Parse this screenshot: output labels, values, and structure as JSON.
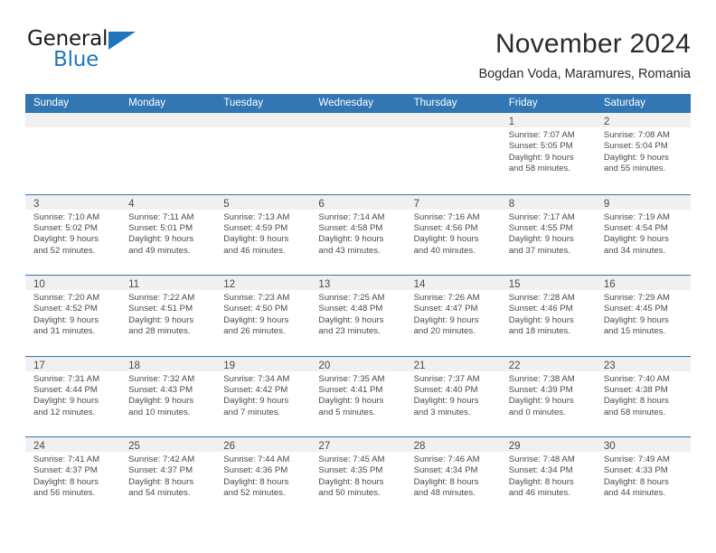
{
  "brand": {
    "name_top": "General",
    "name_bottom": "Blue",
    "accent_color": "#1f76bd",
    "triangle_icon": "brand-triangle-icon"
  },
  "header": {
    "title": "November 2024",
    "subtitle": "Bogdan Voda, Maramures, Romania"
  },
  "theme": {
    "header_blue": "#3276b4",
    "day_band_gray": "#f0f0f0",
    "text_gray": "#4a4a4a"
  },
  "weekdays": [
    "Sunday",
    "Monday",
    "Tuesday",
    "Wednesday",
    "Thursday",
    "Friday",
    "Saturday"
  ],
  "weeks": [
    [
      {
        "day": "",
        "empty": true
      },
      {
        "day": "",
        "empty": true
      },
      {
        "day": "",
        "empty": true
      },
      {
        "day": "",
        "empty": true
      },
      {
        "day": "",
        "empty": true
      },
      {
        "day": "1",
        "sunrise": "Sunrise: 7:07 AM",
        "sunset": "Sunset: 5:05 PM",
        "daylight1": "Daylight: 9 hours",
        "daylight2": "and 58 minutes."
      },
      {
        "day": "2",
        "sunrise": "Sunrise: 7:08 AM",
        "sunset": "Sunset: 5:04 PM",
        "daylight1": "Daylight: 9 hours",
        "daylight2": "and 55 minutes."
      }
    ],
    [
      {
        "day": "3",
        "sunrise": "Sunrise: 7:10 AM",
        "sunset": "Sunset: 5:02 PM",
        "daylight1": "Daylight: 9 hours",
        "daylight2": "and 52 minutes."
      },
      {
        "day": "4",
        "sunrise": "Sunrise: 7:11 AM",
        "sunset": "Sunset: 5:01 PM",
        "daylight1": "Daylight: 9 hours",
        "daylight2": "and 49 minutes."
      },
      {
        "day": "5",
        "sunrise": "Sunrise: 7:13 AM",
        "sunset": "Sunset: 4:59 PM",
        "daylight1": "Daylight: 9 hours",
        "daylight2": "and 46 minutes."
      },
      {
        "day": "6",
        "sunrise": "Sunrise: 7:14 AM",
        "sunset": "Sunset: 4:58 PM",
        "daylight1": "Daylight: 9 hours",
        "daylight2": "and 43 minutes."
      },
      {
        "day": "7",
        "sunrise": "Sunrise: 7:16 AM",
        "sunset": "Sunset: 4:56 PM",
        "daylight1": "Daylight: 9 hours",
        "daylight2": "and 40 minutes."
      },
      {
        "day": "8",
        "sunrise": "Sunrise: 7:17 AM",
        "sunset": "Sunset: 4:55 PM",
        "daylight1": "Daylight: 9 hours",
        "daylight2": "and 37 minutes."
      },
      {
        "day": "9",
        "sunrise": "Sunrise: 7:19 AM",
        "sunset": "Sunset: 4:54 PM",
        "daylight1": "Daylight: 9 hours",
        "daylight2": "and 34 minutes."
      }
    ],
    [
      {
        "day": "10",
        "sunrise": "Sunrise: 7:20 AM",
        "sunset": "Sunset: 4:52 PM",
        "daylight1": "Daylight: 9 hours",
        "daylight2": "and 31 minutes."
      },
      {
        "day": "11",
        "sunrise": "Sunrise: 7:22 AM",
        "sunset": "Sunset: 4:51 PM",
        "daylight1": "Daylight: 9 hours",
        "daylight2": "and 28 minutes."
      },
      {
        "day": "12",
        "sunrise": "Sunrise: 7:23 AM",
        "sunset": "Sunset: 4:50 PM",
        "daylight1": "Daylight: 9 hours",
        "daylight2": "and 26 minutes."
      },
      {
        "day": "13",
        "sunrise": "Sunrise: 7:25 AM",
        "sunset": "Sunset: 4:48 PM",
        "daylight1": "Daylight: 9 hours",
        "daylight2": "and 23 minutes."
      },
      {
        "day": "14",
        "sunrise": "Sunrise: 7:26 AM",
        "sunset": "Sunset: 4:47 PM",
        "daylight1": "Daylight: 9 hours",
        "daylight2": "and 20 minutes."
      },
      {
        "day": "15",
        "sunrise": "Sunrise: 7:28 AM",
        "sunset": "Sunset: 4:46 PM",
        "daylight1": "Daylight: 9 hours",
        "daylight2": "and 18 minutes."
      },
      {
        "day": "16",
        "sunrise": "Sunrise: 7:29 AM",
        "sunset": "Sunset: 4:45 PM",
        "daylight1": "Daylight: 9 hours",
        "daylight2": "and 15 minutes."
      }
    ],
    [
      {
        "day": "17",
        "sunrise": "Sunrise: 7:31 AM",
        "sunset": "Sunset: 4:44 PM",
        "daylight1": "Daylight: 9 hours",
        "daylight2": "and 12 minutes."
      },
      {
        "day": "18",
        "sunrise": "Sunrise: 7:32 AM",
        "sunset": "Sunset: 4:43 PM",
        "daylight1": "Daylight: 9 hours",
        "daylight2": "and 10 minutes."
      },
      {
        "day": "19",
        "sunrise": "Sunrise: 7:34 AM",
        "sunset": "Sunset: 4:42 PM",
        "daylight1": "Daylight: 9 hours",
        "daylight2": "and 7 minutes."
      },
      {
        "day": "20",
        "sunrise": "Sunrise: 7:35 AM",
        "sunset": "Sunset: 4:41 PM",
        "daylight1": "Daylight: 9 hours",
        "daylight2": "and 5 minutes."
      },
      {
        "day": "21",
        "sunrise": "Sunrise: 7:37 AM",
        "sunset": "Sunset: 4:40 PM",
        "daylight1": "Daylight: 9 hours",
        "daylight2": "and 3 minutes."
      },
      {
        "day": "22",
        "sunrise": "Sunrise: 7:38 AM",
        "sunset": "Sunset: 4:39 PM",
        "daylight1": "Daylight: 9 hours",
        "daylight2": "and 0 minutes."
      },
      {
        "day": "23",
        "sunrise": "Sunrise: 7:40 AM",
        "sunset": "Sunset: 4:38 PM",
        "daylight1": "Daylight: 8 hours",
        "daylight2": "and 58 minutes."
      }
    ],
    [
      {
        "day": "24",
        "sunrise": "Sunrise: 7:41 AM",
        "sunset": "Sunset: 4:37 PM",
        "daylight1": "Daylight: 8 hours",
        "daylight2": "and 56 minutes."
      },
      {
        "day": "25",
        "sunrise": "Sunrise: 7:42 AM",
        "sunset": "Sunset: 4:37 PM",
        "daylight1": "Daylight: 8 hours",
        "daylight2": "and 54 minutes."
      },
      {
        "day": "26",
        "sunrise": "Sunrise: 7:44 AM",
        "sunset": "Sunset: 4:36 PM",
        "daylight1": "Daylight: 8 hours",
        "daylight2": "and 52 minutes."
      },
      {
        "day": "27",
        "sunrise": "Sunrise: 7:45 AM",
        "sunset": "Sunset: 4:35 PM",
        "daylight1": "Daylight: 8 hours",
        "daylight2": "and 50 minutes."
      },
      {
        "day": "28",
        "sunrise": "Sunrise: 7:46 AM",
        "sunset": "Sunset: 4:34 PM",
        "daylight1": "Daylight: 8 hours",
        "daylight2": "and 48 minutes."
      },
      {
        "day": "29",
        "sunrise": "Sunrise: 7:48 AM",
        "sunset": "Sunset: 4:34 PM",
        "daylight1": "Daylight: 8 hours",
        "daylight2": "and 46 minutes."
      },
      {
        "day": "30",
        "sunrise": "Sunrise: 7:49 AM",
        "sunset": "Sunset: 4:33 PM",
        "daylight1": "Daylight: 8 hours",
        "daylight2": "and 44 minutes."
      }
    ]
  ]
}
